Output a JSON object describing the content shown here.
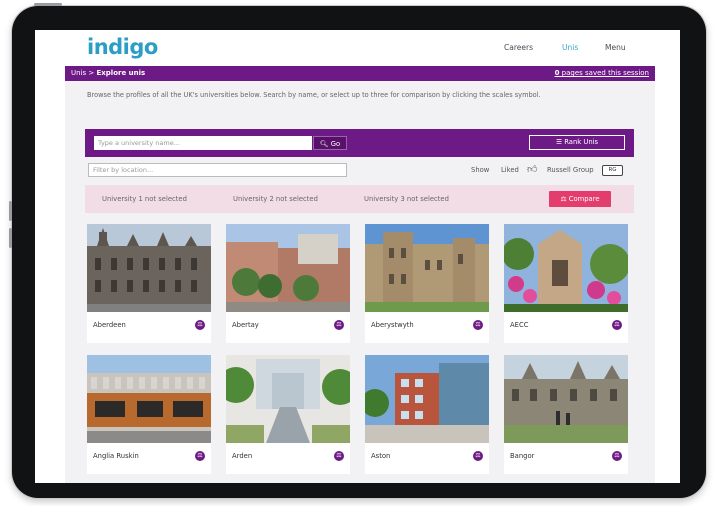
{
  "header": {
    "logo": "indigo",
    "nav": [
      "Careers",
      "Unis",
      "Menu"
    ]
  },
  "breadcrumb": {
    "root": "Unis",
    "sep": ">",
    "current": "Explore unis",
    "saved_count": "0",
    "saved_text": "pages saved this session"
  },
  "intro": "Browse the profiles of all the UK's universities below. Search by name, or select up to three for comparison by clicking the scales symbol.",
  "search": {
    "placeholder": "Type a university name...",
    "go_label": "Go",
    "rank_label": "Rank Unis"
  },
  "filter": {
    "location_placeholder": "Filter by location...",
    "show_label": "Show",
    "liked_label": "Liked",
    "russell_label": "Russell Group",
    "toggle_label": "RG"
  },
  "compare": {
    "slots": [
      "University 1 not selected",
      "University 2 not selected",
      "University 3 not selected"
    ],
    "button_label": "Compare"
  },
  "universities": [
    {
      "name": "Aberdeen",
      "theme": "gothic-stone"
    },
    {
      "name": "Abertay",
      "theme": "modern-brick"
    },
    {
      "name": "Aberystwyth",
      "theme": "castle-stone"
    },
    {
      "name": "AECC",
      "theme": "garden-flowers"
    },
    {
      "name": "Anglia Ruskin",
      "theme": "wood-modern"
    },
    {
      "name": "Arden",
      "theme": "atrium"
    },
    {
      "name": "Aston",
      "theme": "modern-glass"
    },
    {
      "name": "Bangor",
      "theme": "stone-campus"
    }
  ],
  "colors": {
    "brand_purple": "#6d1a86",
    "logo_blue": "#2c9ec6",
    "compare_pink": "#e23d6d",
    "compare_bg": "#f2dde6"
  }
}
